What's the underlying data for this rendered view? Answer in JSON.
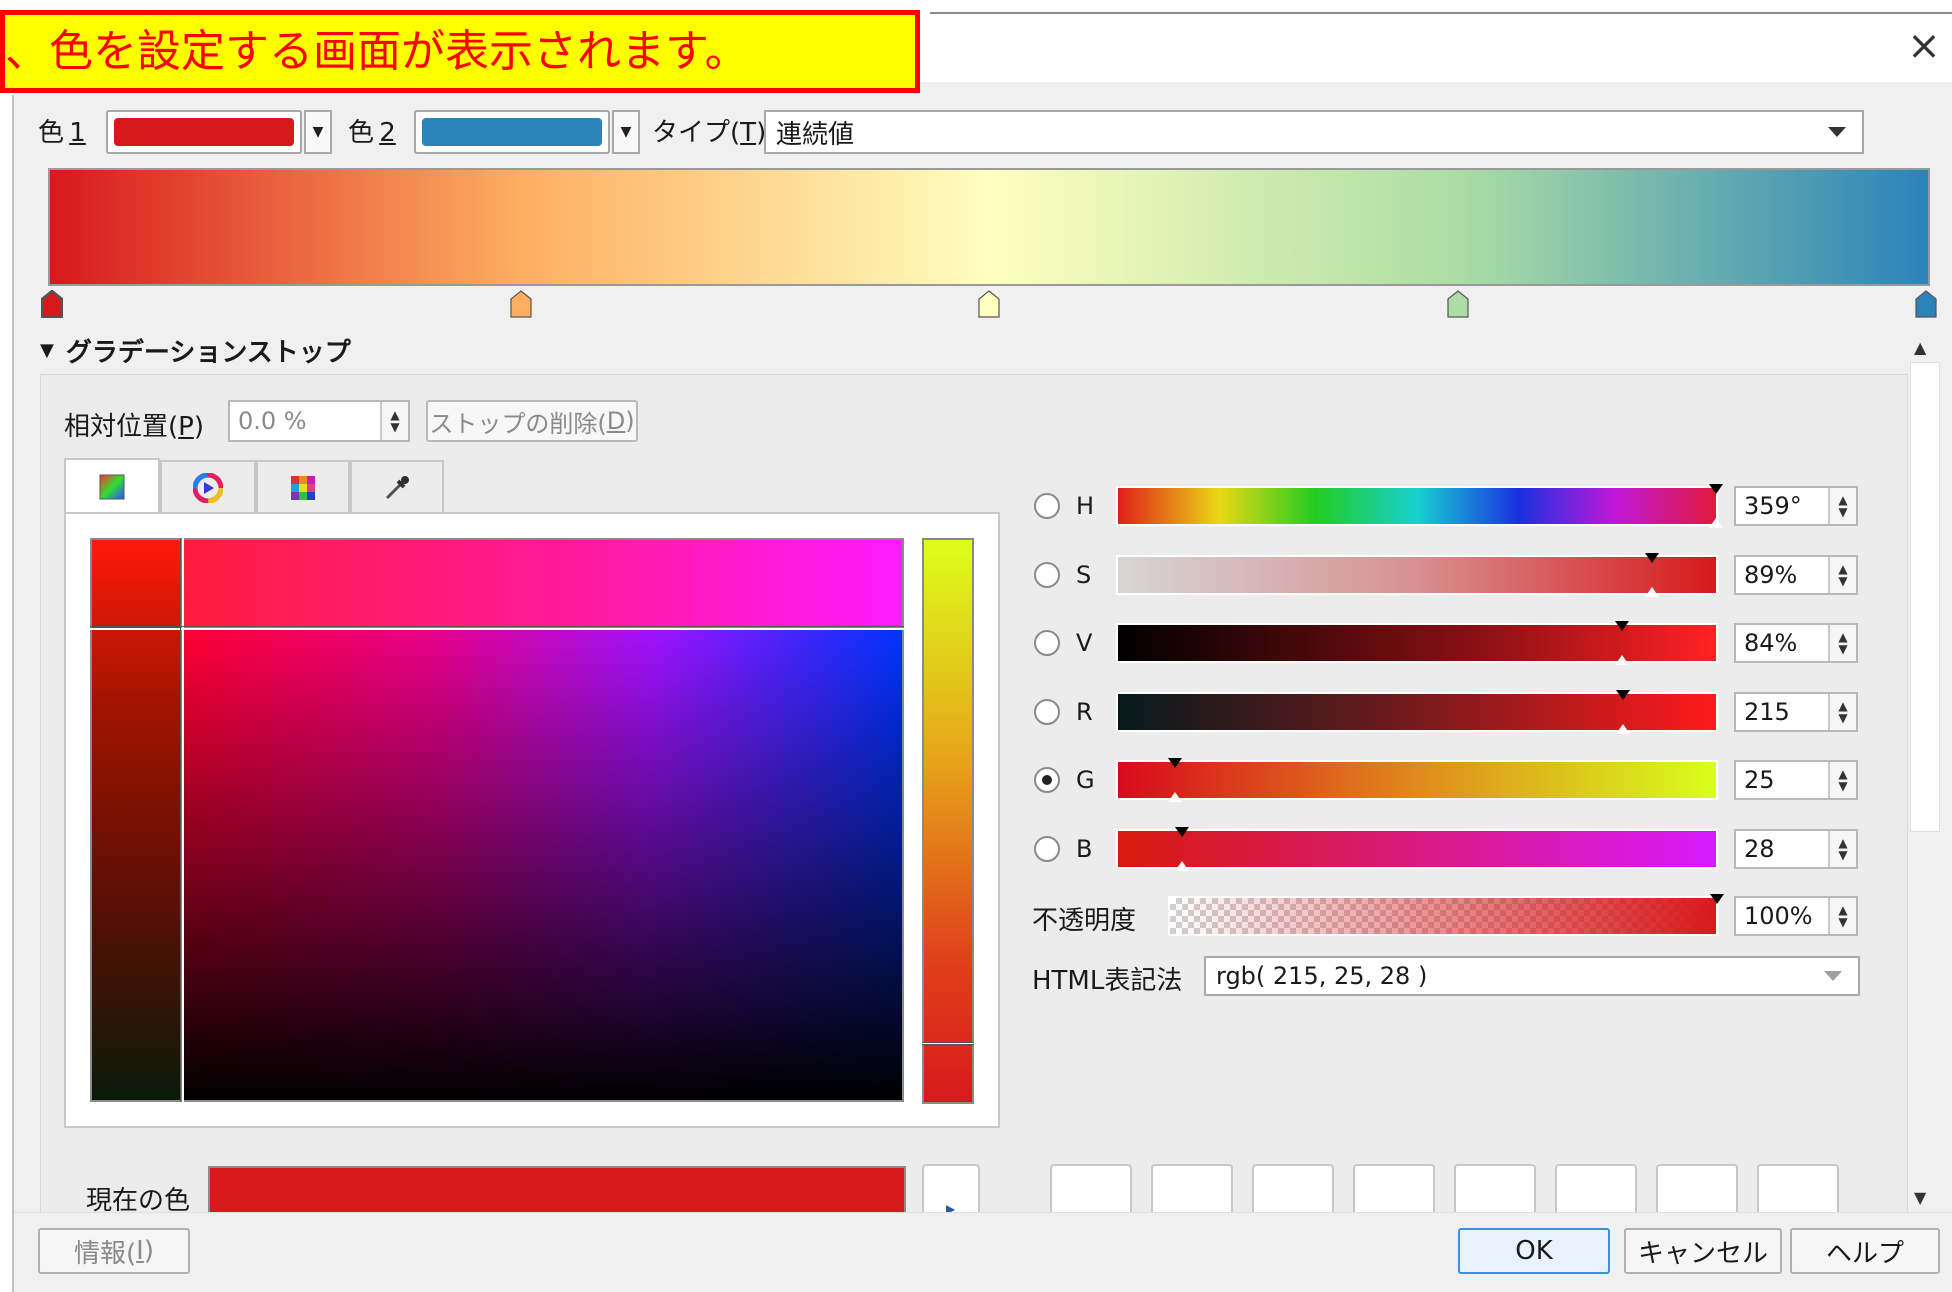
{
  "caption": "、色を設定する画面が表示されます。",
  "window": {
    "close_glyph": "×"
  },
  "ramp": {
    "color1": {
      "label": "色",
      "accel": "1",
      "color": "#d7191c"
    },
    "color2": {
      "label": "色",
      "accel": "2",
      "color": "#2b83ba"
    },
    "type": {
      "label": "タイプ",
      "accel": "T",
      "value": "連続値"
    },
    "stops": [
      "#d7191c",
      "#fdae61",
      "#ffffbf",
      "#abdda4",
      "#2b83ba"
    ]
  },
  "section": {
    "title": "グラデーションストップ"
  },
  "stop_editor": {
    "position_label": "相対位置(",
    "position_accel": "P",
    "position_label_end": ")",
    "position_value": "0.0 %",
    "delete_label": "ストップの削除(",
    "delete_accel": "D",
    "delete_label_end": ")"
  },
  "tabs": [
    {
      "name": "color-ramp-tab-icon",
      "active": true
    },
    {
      "name": "color-wheel-tab-icon",
      "active": false
    },
    {
      "name": "swatch-grid-tab-icon",
      "active": false
    },
    {
      "name": "eyedropper-tab-icon",
      "active": false
    }
  ],
  "channels": [
    {
      "label": "H",
      "value": "359°",
      "checked": false,
      "fraction": 0.997
    },
    {
      "label": "S",
      "value": "89%",
      "checked": false,
      "fraction": 0.89
    },
    {
      "label": "V",
      "value": "84%",
      "checked": false,
      "fraction": 0.84
    },
    {
      "label": "R",
      "value": "215",
      "checked": false,
      "fraction": 0.843
    },
    {
      "label": "G",
      "value": "25",
      "checked": true,
      "fraction": 0.098
    },
    {
      "label": "B",
      "value": "28",
      "checked": false,
      "fraction": 0.11
    }
  ],
  "opacity": {
    "label": "不透明度",
    "value": "100%",
    "fraction": 1.0
  },
  "html_notation": {
    "label": "HTML表記法",
    "value": "rgb( 215, 25, 28 )"
  },
  "current_color": {
    "label": "現在の色",
    "color": "#d7191c"
  },
  "footer": {
    "info_label": "情報(",
    "info_accel": "I",
    "info_end": ")",
    "ok": "OK",
    "cancel": "キャンセル",
    "help": "ヘルプ"
  }
}
